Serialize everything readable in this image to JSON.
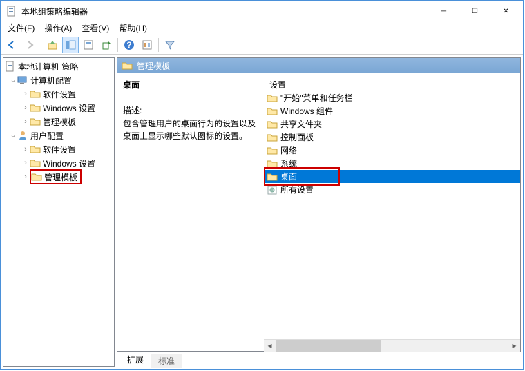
{
  "titlebar": {
    "title": "本地组策略编辑器"
  },
  "menu": {
    "file": "文件(F)",
    "action": "操作(A)",
    "view": "查看(V)",
    "help": "帮助(H)"
  },
  "tree": {
    "root": "本地计算机 策略",
    "computer": "计算机配置",
    "computer_children": {
      "software": "软件设置",
      "windows": "Windows 设置",
      "admin": "管理模板"
    },
    "user": "用户配置",
    "user_children": {
      "software": "软件设置",
      "windows": "Windows 设置",
      "admin": "管理模板"
    }
  },
  "header": {
    "path": "管理模板"
  },
  "leftcol": {
    "title": "桌面",
    "desc_label": "描述:",
    "desc_body": "包含管理用户的桌面行为的设置以及桌面上显示哪些默认图标的设置。"
  },
  "rightcol": {
    "header": "设置",
    "items": [
      {
        "label": "\"开始\"菜单和任务栏",
        "type": "folder"
      },
      {
        "label": "Windows 组件",
        "type": "folder"
      },
      {
        "label": "共享文件夹",
        "type": "folder"
      },
      {
        "label": "控制面板",
        "type": "folder"
      },
      {
        "label": "网络",
        "type": "folder"
      },
      {
        "label": "系统",
        "type": "folder"
      },
      {
        "label": "桌面",
        "type": "folder",
        "selected": true
      },
      {
        "label": "所有设置",
        "type": "settings"
      }
    ]
  },
  "tabs": {
    "extended": "扩展",
    "standard": "标准"
  }
}
